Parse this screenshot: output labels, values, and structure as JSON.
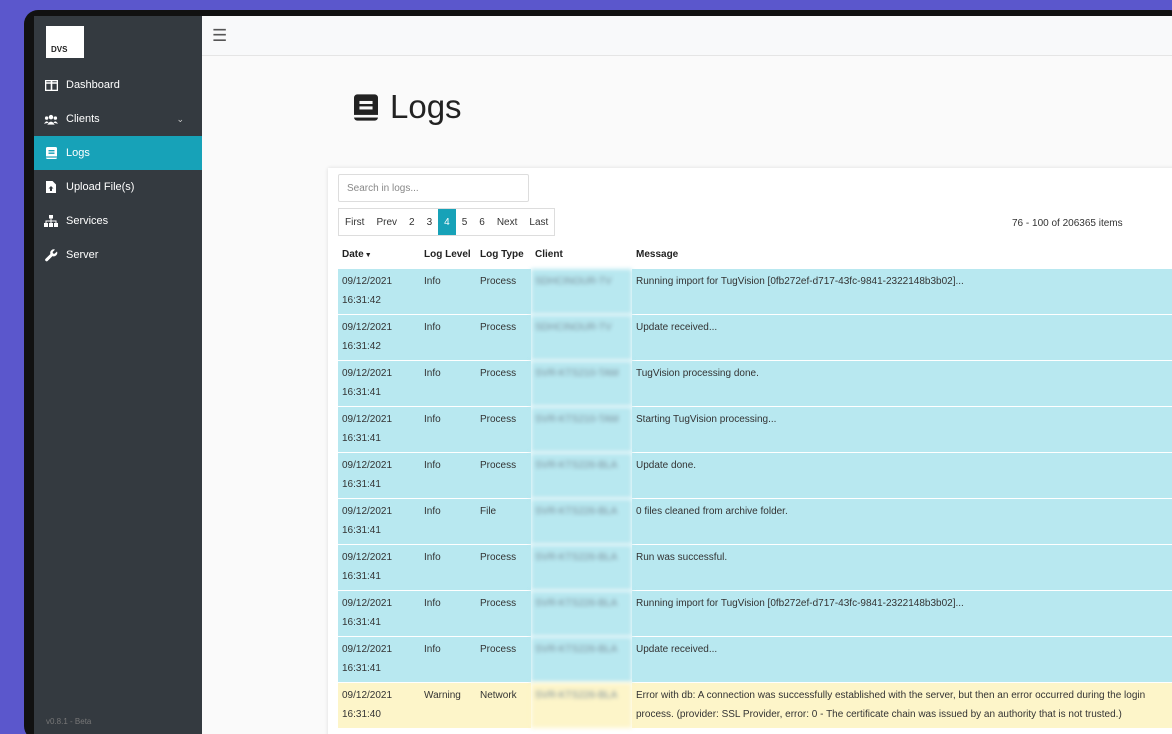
{
  "sidebar": {
    "brand": "DVS",
    "version": "v0.8.1 - Beta",
    "items": [
      {
        "label": "Dashboard"
      },
      {
        "label": "Clients"
      },
      {
        "label": "Logs"
      },
      {
        "label": "Upload File(s)"
      },
      {
        "label": "Services"
      },
      {
        "label": "Server"
      }
    ]
  },
  "page": {
    "title": "Logs"
  },
  "search": {
    "placeholder": "Search in logs..."
  },
  "pagination": {
    "first": "First",
    "prev": "Prev",
    "p2": "2",
    "p3": "3",
    "p4": "4",
    "p5": "5",
    "p6": "6",
    "next": "Next",
    "last": "Last",
    "info": "76 - 100 of 206365 items"
  },
  "table": {
    "headers": {
      "date": "Date",
      "level": "Log Level",
      "type": "Log Type",
      "client": "Client",
      "message": "Message"
    },
    "rows": [
      {
        "date": "09/12/2021 16:31:42",
        "level": "Info",
        "type": "Process",
        "client": "SDHCINOUR-TV",
        "message": "Running import for TugVision [0fb272ef-d717-43fc-9841-2322148b3b02]..."
      },
      {
        "date": "09/12/2021 16:31:42",
        "level": "Info",
        "type": "Process",
        "client": "SDHCINOUR-TV",
        "message": "Update received..."
      },
      {
        "date": "09/12/2021 16:31:41",
        "level": "Info",
        "type": "Process",
        "client": "SVR-KTS210-TAM",
        "message": "TugVision processing done."
      },
      {
        "date": "09/12/2021 16:31:41",
        "level": "Info",
        "type": "Process",
        "client": "SVR-KTS210-TAM",
        "message": "Starting TugVision processing..."
      },
      {
        "date": "09/12/2021 16:31:41",
        "level": "Info",
        "type": "Process",
        "client": "SVR-KTS226-BLA",
        "message": "Update done."
      },
      {
        "date": "09/12/2021 16:31:41",
        "level": "Info",
        "type": "File",
        "client": "SVR-KTS226-BLA",
        "message": "0 files cleaned from archive folder."
      },
      {
        "date": "09/12/2021 16:31:41",
        "level": "Info",
        "type": "Process",
        "client": "SVR-KTS226-BLA",
        "message": "Run was successful."
      },
      {
        "date": "09/12/2021 16:31:41",
        "level": "Info",
        "type": "Process",
        "client": "SVR-KTS226-BLA",
        "message": "Running import for TugVision [0fb272ef-d717-43fc-9841-2322148b3b02]..."
      },
      {
        "date": "09/12/2021 16:31:41",
        "level": "Info",
        "type": "Process",
        "client": "SVR-KTS226-BLA",
        "message": "Update received..."
      },
      {
        "date": "09/12/2021 16:31:40",
        "level": "Warning",
        "type": "Network",
        "client": "SVR-KTS226-BLA",
        "message": "Error with db: A connection was successfully established with the server, but then an error occurred during the login process. (provider: SSL Provider, error: 0 - The certificate chain was issued by an authority that is not trusted.)"
      }
    ]
  },
  "colors": {
    "accent": "#17a2b8",
    "sidebar": "#343a40",
    "info_row": "#b8e8f0",
    "warning_row": "#fdf5c9",
    "background": "#5b57cc"
  }
}
